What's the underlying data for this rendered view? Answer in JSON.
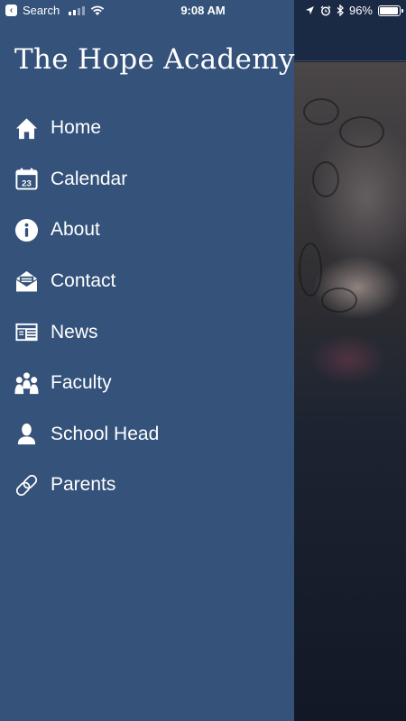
{
  "status_bar": {
    "back_label": "Search",
    "time": "9:08 AM",
    "battery": "96%",
    "battery_level": 0.96
  },
  "background": {
    "header_title_fragment": "y"
  },
  "drawer": {
    "title": "The Hope Academy",
    "items": [
      {
        "label": "Home",
        "icon": "home-icon"
      },
      {
        "label": "Calendar",
        "icon": "calendar-icon",
        "icon_text": "23"
      },
      {
        "label": "About",
        "icon": "info-icon"
      },
      {
        "label": "Contact",
        "icon": "envelope-icon"
      },
      {
        "label": "News",
        "icon": "newspaper-icon"
      },
      {
        "label": "Faculty",
        "icon": "people-icon"
      },
      {
        "label": "School Head",
        "icon": "person-icon"
      },
      {
        "label": "Parents",
        "icon": "link-icon"
      }
    ]
  }
}
